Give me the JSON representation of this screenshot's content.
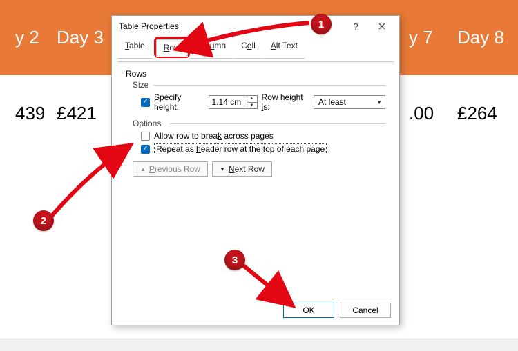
{
  "table": {
    "head": [
      "y 2",
      "Day 3",
      "y 7",
      "Day 8"
    ],
    "row": [
      "439",
      "£421",
      ".00",
      "£264"
    ]
  },
  "dialog": {
    "title": "Table Properties",
    "tabs": {
      "table": "Table",
      "row": "Row",
      "column": "Column",
      "cell": "Cell",
      "alt": "Alt Text"
    },
    "rows_label": "Rows",
    "size_label": "Size",
    "specify_height": "Specify height:",
    "height_value": "1.14 cm",
    "row_height_is": "Row height is:",
    "row_height_mode": "At least",
    "options_label": "Options",
    "allow_break": "Allow row to break across pages",
    "repeat_header": "Repeat as header row at the top of each page",
    "prev_row": "Previous Row",
    "next_row": "Next Row",
    "ok": "OK",
    "cancel": "Cancel"
  },
  "annotations": {
    "one": "1",
    "two": "2",
    "three": "3"
  }
}
